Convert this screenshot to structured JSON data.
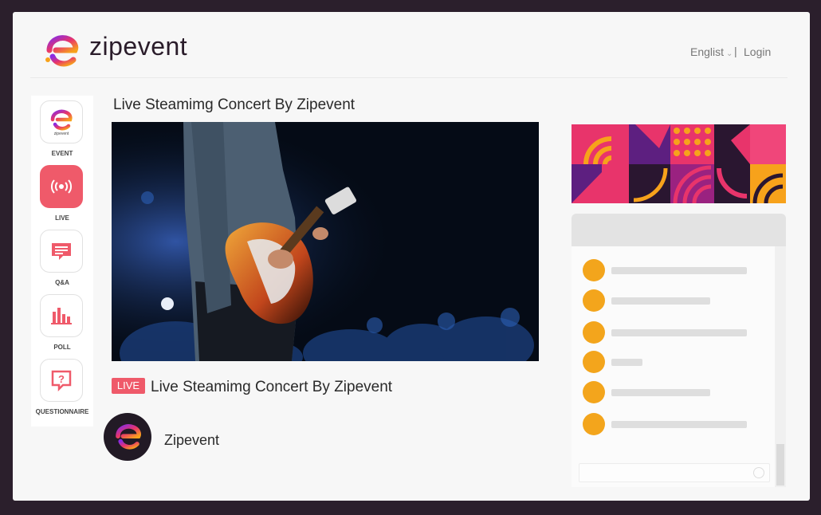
{
  "header": {
    "brand": "zipevent",
    "language": "Englist",
    "separator": "|",
    "login": "Login"
  },
  "nav": {
    "items": [
      {
        "label": "EVENT",
        "icon": "zipevent-logo-icon",
        "active": false,
        "sub": "zipevent"
      },
      {
        "label": "LIVE",
        "icon": "broadcast-icon",
        "active": true
      },
      {
        "label": "Q&A",
        "icon": "chat-bubble-icon",
        "active": false
      },
      {
        "label": "POLL",
        "icon": "bar-chart-icon",
        "active": false
      },
      {
        "label": "QUESTIONNAIRE",
        "icon": "question-bubble-icon",
        "active": false
      }
    ]
  },
  "main": {
    "page_title": "Live Steamimg Concert By Zipevent",
    "live_badge": "LIVE",
    "stream_title": "Live Steamimg Concert By Zipevent",
    "organizer": "Zipevent"
  },
  "colors": {
    "accent": "#ef5a6a",
    "dot": "#f3a51c",
    "dark": "#2a1c2a"
  },
  "chat": {
    "rows": [
      {
        "bar": 0.74
      },
      {
        "bar": 0.54
      },
      {
        "bar": 0.74
      },
      {
        "bar": 0.17
      },
      {
        "bar": 0.54
      },
      {
        "bar": 0.74
      }
    ]
  }
}
